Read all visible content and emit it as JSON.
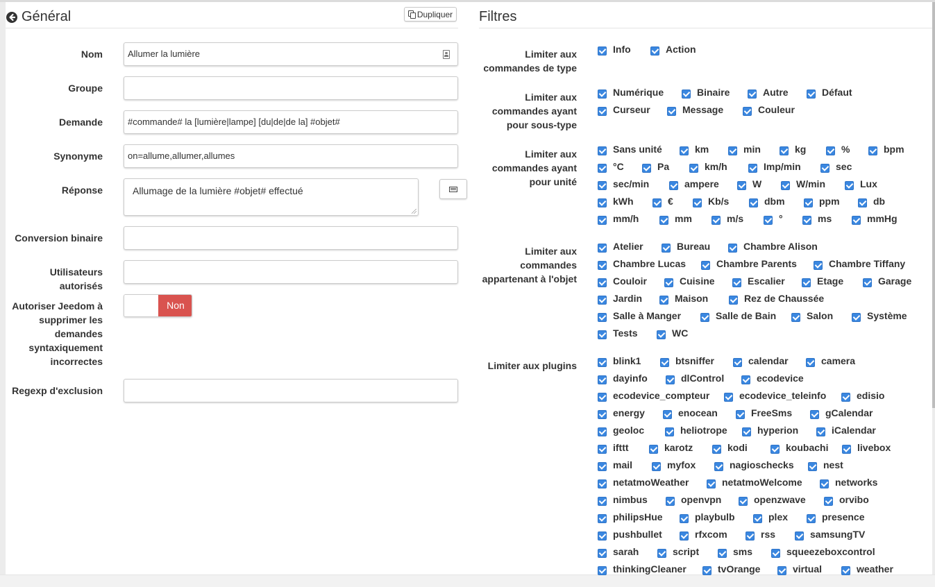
{
  "general": {
    "title": "Général",
    "duplicate_label": "Dupliquer",
    "fields": {
      "nom": {
        "label": "Nom",
        "value": "Allumer la lumière"
      },
      "groupe": {
        "label": "Groupe",
        "value": ""
      },
      "demande": {
        "label": "Demande",
        "value": "#commande# la [lumière|lampe] [du|de|de la] #objet#"
      },
      "synonyme": {
        "label": "Synonyme",
        "value": "on=allume,allumer,allumes"
      },
      "reponse": {
        "label": "Réponse",
        "value": "Allumage de la lumière #objet# effectué"
      },
      "conversion": {
        "label": "Conversion binaire",
        "value": ""
      },
      "utilisateurs": {
        "label": "Utilisateurs autorisés",
        "value": ""
      },
      "autoriser": {
        "label_lines": [
          "Autoriser Jeedom à",
          "supprimer les",
          "demandes",
          "syntaxiquement",
          "incorrectes"
        ],
        "toggle_label": "Non",
        "enabled": false
      },
      "regexp": {
        "label": "Regexp d'exclusion",
        "value": ""
      }
    }
  },
  "filtres": {
    "title": "Filtres",
    "type": {
      "label_lines": [
        "Limiter aux",
        "commandes de type"
      ],
      "items": [
        "Info",
        "Action"
      ]
    },
    "subtype": {
      "label_lines": [
        "Limiter aux",
        "commandes ayant",
        "pour sous-type"
      ],
      "items": [
        "Numérique",
        "Binaire",
        "Autre",
        "Défaut",
        "Curseur",
        "Message",
        "Couleur"
      ]
    },
    "unit": {
      "label_lines": [
        "Limiter aux",
        "commandes ayant",
        "pour unité"
      ],
      "items": [
        "Sans unité",
        "km",
        "min",
        "kg",
        "%",
        "bpm",
        "°C",
        "Pa",
        "km/h",
        "Imp/min",
        "sec",
        "sec/min",
        "ampere",
        "W",
        "W/min",
        "Lux",
        "kWh",
        "€",
        "Kb/s",
        "dbm",
        "ppm",
        "db",
        "mm/h",
        "mm",
        "m/s",
        "°",
        "ms",
        "mmHg"
      ]
    },
    "object": {
      "label_lines": [
        "Limiter aux",
        "commandes",
        "appartenant à l'objet"
      ],
      "items": [
        "Atelier",
        "Bureau",
        "Chambre Alison",
        "Chambre Lucas",
        "Chambre Parents",
        "Chambre Tiffany",
        "Couloir",
        "Cuisine",
        "Escalier",
        "Etage",
        "Garage",
        "Jardin",
        "Maison",
        "Rez de Chaussée",
        "Salle à Manger",
        "Salle de Bain",
        "Salon",
        "Système",
        "Tests",
        "WC"
      ]
    },
    "plugins": {
      "label_lines": [
        "Limiter aux plugins"
      ],
      "items": [
        "blink1",
        "btsniffer",
        "calendar",
        "camera",
        "dayinfo",
        "dlControl",
        "ecodevice",
        "ecodevice_compteur",
        "ecodevice_teleinfo",
        "edisio",
        "energy",
        "enocean",
        "FreeSms",
        "gCalendar",
        "geoloc",
        "heliotrope",
        "hyperion",
        "iCalendar",
        "ifttt",
        "karotz",
        "kodi",
        "koubachi",
        "livebox",
        "mail",
        "myfox",
        "nagioschecks",
        "nest",
        "netatmoWeather",
        "netatmoWelcome",
        "networks",
        "nimbus",
        "openvpn",
        "openzwave",
        "orvibo",
        "philipsHue",
        "playbulb",
        "plex",
        "presence",
        "pushbullet",
        "rfxcom",
        "rss",
        "samsungTV",
        "sarah",
        "script",
        "sms",
        "squeezeboxcontrol",
        "thinkingCleaner",
        "tvOrange",
        "virtual",
        "weather"
      ]
    }
  },
  "icons": {
    "back": "arrow-circle-left-icon",
    "duplicate": "copy-icon",
    "contact": "contact-card-icon",
    "list": "list-icon",
    "checkbox": "checkbox-checked-icon"
  },
  "colors": {
    "accent": "#3a87e0",
    "danger": "#d9534f",
    "text": "#333333"
  }
}
